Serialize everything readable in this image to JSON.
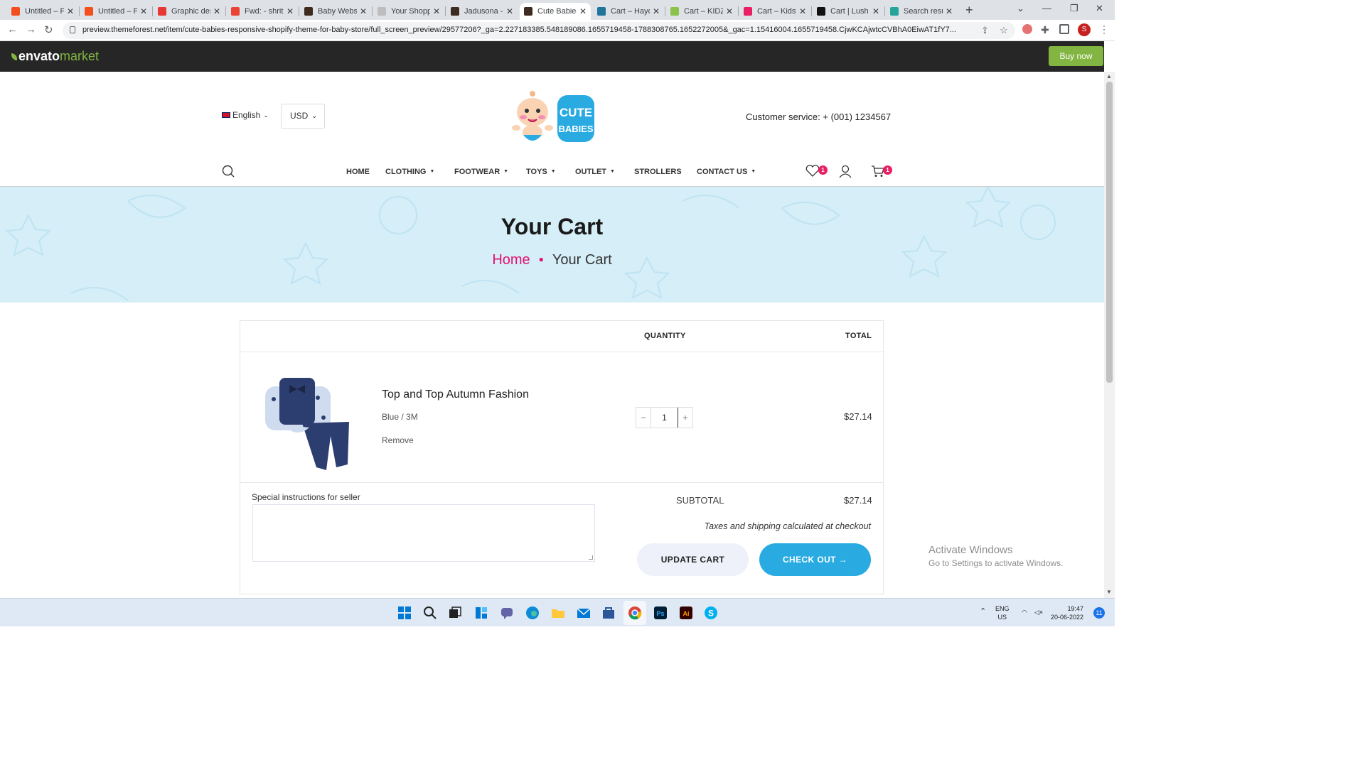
{
  "browser": {
    "tabs": [
      {
        "title": "Untitled – F",
        "color": "#f24e1e"
      },
      {
        "title": "Untitled – F",
        "color": "#f24e1e"
      },
      {
        "title": "Graphic des",
        "color": "#e53935"
      },
      {
        "title": "Fwd: - shrit",
        "color": "#ea4335"
      },
      {
        "title": "Baby Websi",
        "color": "#3d2b1f"
      },
      {
        "title": "Your Shopp",
        "color": "#bdbdbd"
      },
      {
        "title": "Jadusona -",
        "color": "#3d2b1f"
      },
      {
        "title": "Cute Babies",
        "color": "#3d2b1f"
      },
      {
        "title": "Cart – Hayd",
        "color": "#21759b"
      },
      {
        "title": "Cart – KIDZ",
        "color": "#8bc34a"
      },
      {
        "title": "Cart – Kidsy",
        "color": "#e91e63"
      },
      {
        "title": "Cart | Lush",
        "color": "#111111"
      },
      {
        "title": "Search resu",
        "color": "#26a69a"
      }
    ],
    "active_tab": 7,
    "url": "preview.themeforest.net/item/cute-babies-responsive-shopify-theme-for-baby-store/full_screen_preview/29577206?_ga=2.227183385.548189086.1655719458-1788308765.1652272005&_gac=1.15416004.1655719458.CjwKCAjwtcCVBhA0EiwAT1fY7...",
    "profile_initial": "S"
  },
  "envato": {
    "logo_main": "envato",
    "logo_sub": "market",
    "buy_now": "Buy now"
  },
  "store": {
    "language": "English",
    "currency": "USD",
    "logo_text_1": "CUTE",
    "logo_text_2": "BABIES",
    "customer_service": "Customer service: + (001) 1234567",
    "menu": [
      "HOME",
      "CLOTHING",
      "FOOTWEAR",
      "TOYS",
      "OUTLET",
      "STROLLERS",
      "CONTACT US"
    ],
    "wishlist_count": "1",
    "cart_count": "1"
  },
  "banner": {
    "title": "Your Cart",
    "crumb_home": "Home",
    "crumb_current": "Your Cart"
  },
  "cart": {
    "col_quantity": "QUANTITY",
    "col_total": "TOTAL",
    "item": {
      "title": "Top and Top Autumn Fashion",
      "variant": "Blue / 3M",
      "remove": "Remove",
      "quantity": "1",
      "total": "$27.14"
    },
    "instructions_label": "Special instructions for seller",
    "subtotal_label": "SUBTOTAL",
    "subtotal_value": "$27.14",
    "taxes_note": "Taxes and shipping calculated at checkout",
    "update_label": "UPDATE CART",
    "checkout_label": "CHECK OUT →"
  },
  "watermark": {
    "line1": "Activate Windows",
    "line2": "Go to Settings to activate Windows."
  },
  "taskbar": {
    "lang_1": "ENG",
    "lang_2": "US",
    "time": "19:47",
    "date": "20-06-2022",
    "notifications": "11"
  }
}
